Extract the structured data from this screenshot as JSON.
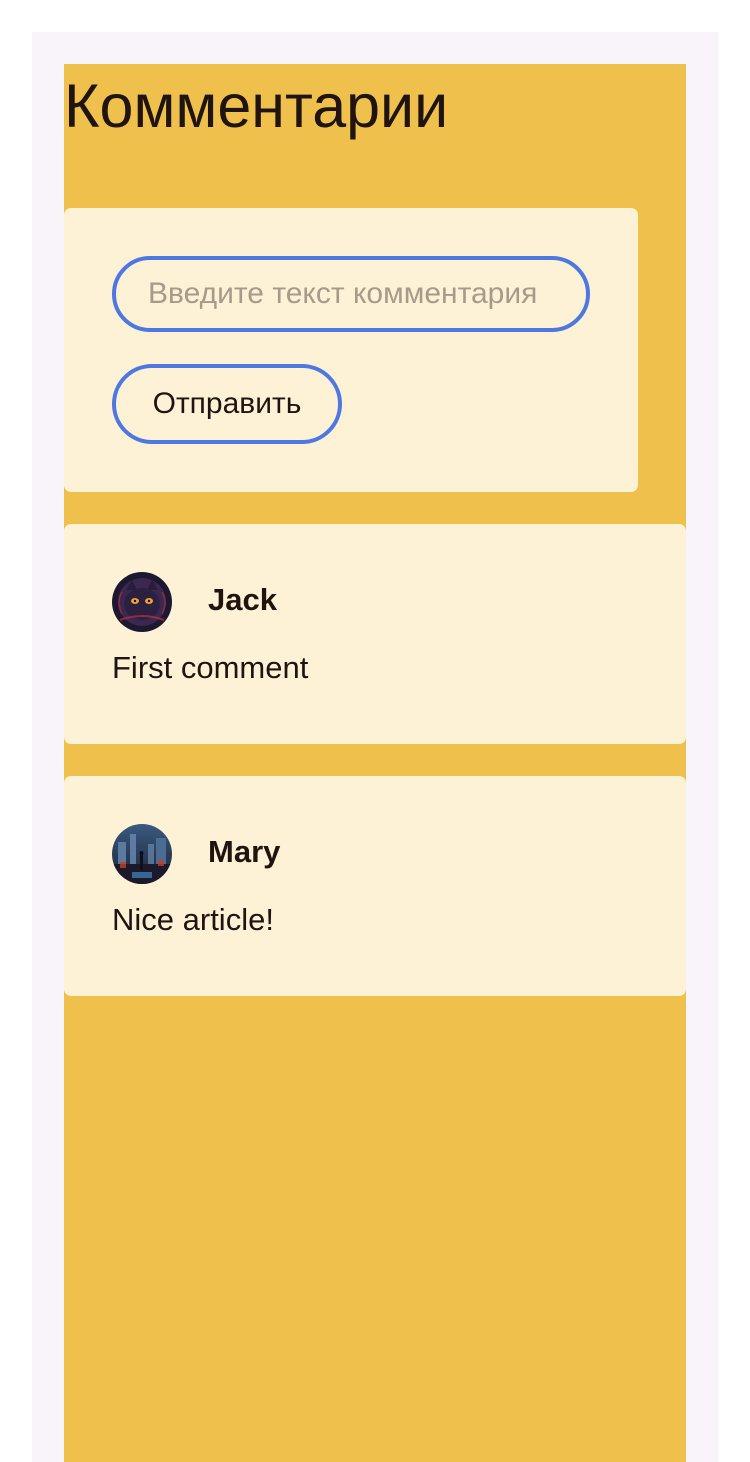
{
  "page": {
    "title": "Комментарии"
  },
  "form": {
    "input_placeholder": "Введите текст комментария",
    "input_value": "",
    "submit_label": "Отправить"
  },
  "comments": [
    {
      "author": "Jack",
      "text": "First comment",
      "avatar_icon": "cat-avatar"
    },
    {
      "author": "Mary",
      "text": "Nice article!",
      "avatar_icon": "city-avatar"
    }
  ],
  "colors": {
    "background": "#efc04b",
    "card": "#fdf2d6",
    "accent_border": "#4e77e1",
    "text": "#1f1410"
  }
}
